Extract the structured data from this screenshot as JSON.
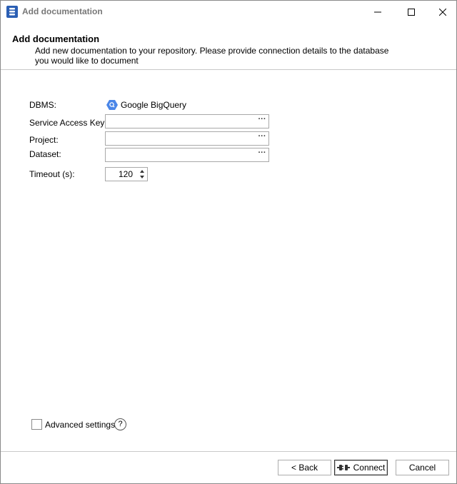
{
  "window": {
    "title": "Add documentation",
    "icons": {
      "app": "database-doc-icon",
      "minimize": "minimize-icon",
      "maximize": "maximize-icon",
      "close": "close-icon"
    }
  },
  "header": {
    "title": "Add documentation",
    "description": "Add new documentation to your repository. Please provide connection details to the database you would like to document"
  },
  "form": {
    "dbms": {
      "label": "DBMS:",
      "value": "Google BigQuery",
      "icon": "bigquery-icon"
    },
    "service_key": {
      "label": "Service Access Key:",
      "value": "",
      "browse": "···"
    },
    "project": {
      "label": "Project:",
      "value": "",
      "browse": "···"
    },
    "dataset": {
      "label": "Dataset:",
      "value": "",
      "browse": "···"
    },
    "timeout": {
      "label": "Timeout (s):",
      "value": "120"
    }
  },
  "advanced": {
    "label": "Advanced settings",
    "checked": false,
    "help": "?"
  },
  "buttons": {
    "back": "< Back",
    "connect": "Connect",
    "cancel": "Cancel"
  },
  "colors": {
    "accent": "#2b5fb4",
    "bigquery": "#4a86e8"
  }
}
